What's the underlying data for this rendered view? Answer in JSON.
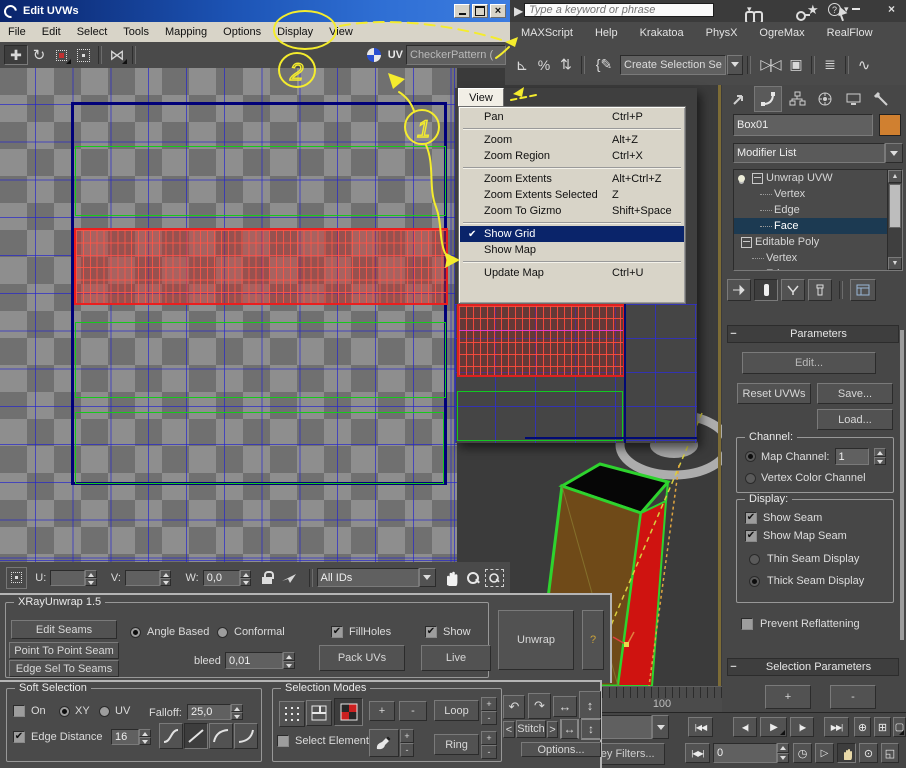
{
  "window": {
    "title": "Edit UVWs",
    "menus": [
      "File",
      "Edit",
      "Select",
      "Tools",
      "Mapping",
      "Options",
      "Display",
      "View"
    ],
    "texture_dropdown": "CheckerPattern (",
    "uv_badge": "UV"
  },
  "status_bar": {
    "u_label": "U:",
    "v_label": "V:",
    "w_label": "W:",
    "w_value": "0,0",
    "ids_dropdown": "All IDs"
  },
  "view_menu": {
    "title": "View",
    "items": [
      {
        "label": "Pan",
        "shortcut": "Ctrl+P"
      },
      {
        "label": "Zoom",
        "shortcut": "Alt+Z"
      },
      {
        "label": "Zoom Region",
        "shortcut": "Ctrl+X"
      },
      {
        "label": "Zoom Extents",
        "shortcut": "Alt+Ctrl+Z"
      },
      {
        "label": "Zoom Extents Selected",
        "shortcut": "Z"
      },
      {
        "label": "Zoom To Gizmo",
        "shortcut": "Shift+Space"
      },
      {
        "label": "Show Grid",
        "shortcut": "",
        "checked": true,
        "highlighted": true
      },
      {
        "label": "Show Map",
        "shortcut": ""
      },
      {
        "label": "Update Map",
        "shortcut": "Ctrl+U"
      }
    ]
  },
  "top_bar": {
    "search_placeholder": "Type a keyword or phrase"
  },
  "max_menus": [
    "MAXScript",
    "Help",
    "Krakatoa",
    "PhysX",
    "OgreMax",
    "RealFlow"
  ],
  "main_toolbar": {
    "selection_set_dropdown": "Create Selection Se"
  },
  "command_panel": {
    "object_name": "Box01",
    "modifier_list": "Modifier List",
    "stack": [
      {
        "label": "Unwrap UVW"
      },
      {
        "label": "Vertex"
      },
      {
        "label": "Edge"
      },
      {
        "label": "Face"
      },
      {
        "label": "Editable Poly"
      },
      {
        "label": "Vertex"
      },
      {
        "label": "Edge"
      }
    ],
    "parameters": {
      "header": "Parameters",
      "edit": "Edit...",
      "reset": "Reset UVWs",
      "save": "Save...",
      "load": "Load...",
      "channel_group": "Channel:",
      "map_channel": "Map Channel:",
      "map_channel_value": "1",
      "vertex_color": "Vertex Color Channel",
      "display_group": "Display:",
      "show_seam": "Show Seam",
      "show_map_seam": "Show Map Seam",
      "thin_seam": "Thin Seam Display",
      "thick_seam": "Thick Seam Display",
      "prevent": "Prevent Reflattening"
    },
    "selection_parameters": {
      "header": "Selection Parameters",
      "plus": "+",
      "minus": "-"
    }
  },
  "xray": {
    "title": "XRayUnwrap 1.5",
    "edit_seams": "Edit Seams",
    "point_to_point": "Point To Point Seam",
    "edge_sel": "Edge Sel To Seams",
    "angle_based": "Angle Based",
    "conformal": "Conformal",
    "fill_holes": "FillHoles",
    "show": "Show",
    "bleed_label": "bleed",
    "bleed_value": "0,01",
    "pack_uvs": "Pack UVs",
    "live": "Live",
    "unwrap": "Unwrap",
    "help": "?"
  },
  "soft_selection": {
    "title": "Soft Selection",
    "on": "On",
    "xy": "XY",
    "uv": "UV",
    "falloff_label": "Falloff:",
    "falloff_value": "25,0",
    "edge_distance": "Edge Distance",
    "edge_distance_value": "16"
  },
  "selection_modes": {
    "title": "Selection Modes",
    "plus": "+",
    "minus": "-",
    "loop": "Loop",
    "ring": "Ring",
    "select_element": "Select Element",
    "stitch_left": "<",
    "stitch": "Stitch",
    "stitch_right": ">",
    "options": "Options..."
  },
  "timeline": {
    "end_frame": "100",
    "current_frame": "0",
    "key_filters": "Key Filters..."
  },
  "annotations": {
    "n1": "1",
    "n2": "2"
  },
  "colors": {
    "accent_navy": "#0a246a",
    "seam_green": "#15c81c",
    "selection_red": "#ea1e1e",
    "annotation_yellow": "#f4ec2d",
    "object_swatch": "#d08030"
  }
}
